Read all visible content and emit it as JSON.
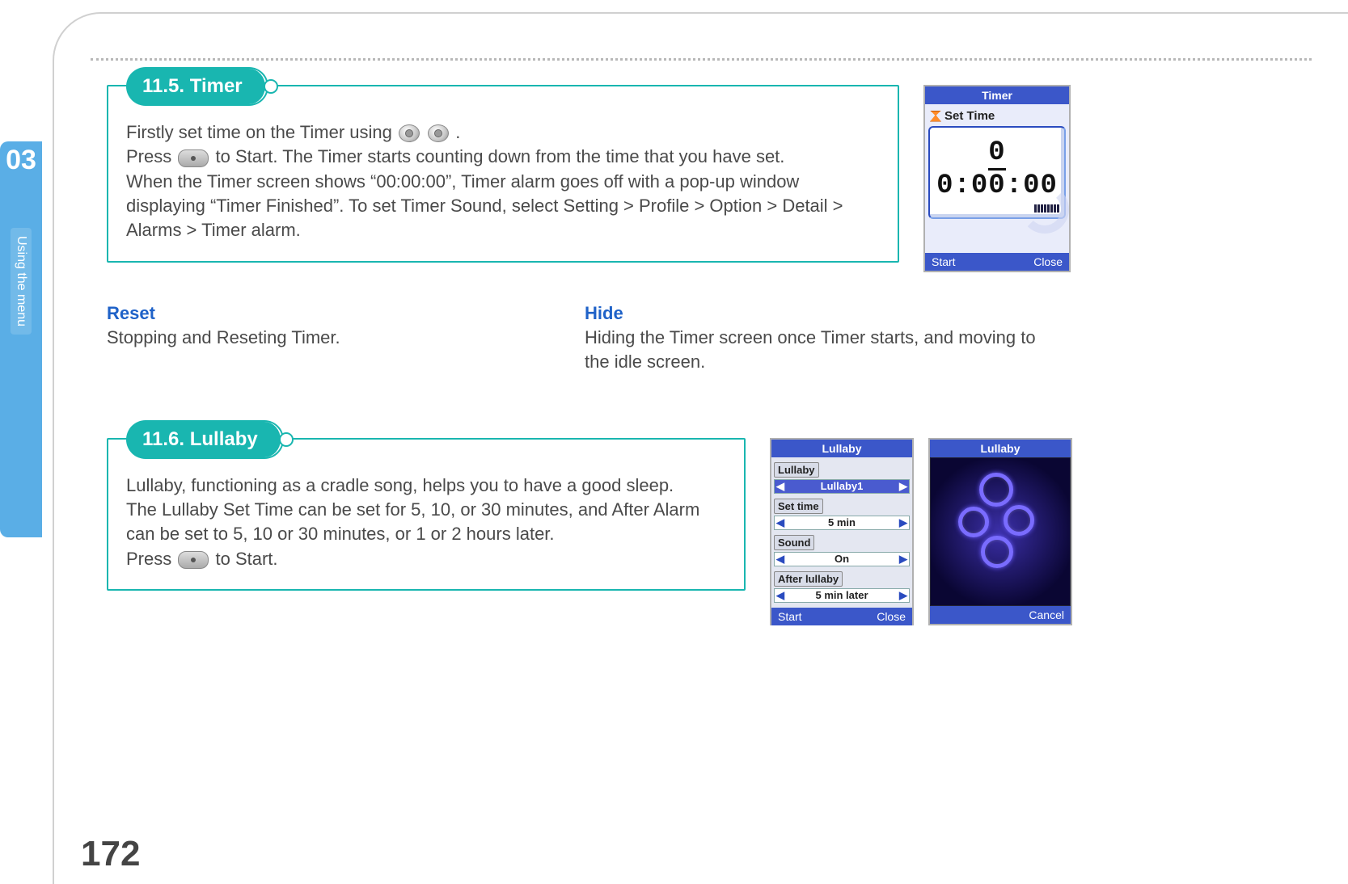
{
  "chapter": {
    "number": "03",
    "title": "Using the menu"
  },
  "page_number": "172",
  "section_timer": {
    "heading": "11.5. Timer",
    "line1_a": "Firstly set time on the Timer using ",
    "line1_b": ".",
    "line2_a": "Press ",
    "line2_b": " to Start. The Timer starts counting down from the time that you have set.",
    "line3": "When the Timer screen shows “00:00:00”, Timer alarm goes off with a pop-up window displaying “Timer Finished”. To set Timer Sound, select Setting > Profile > Option > Detail > Alarms > Timer alarm."
  },
  "reset": {
    "heading": "Reset",
    "body": "Stopping and Reseting Timer."
  },
  "hide": {
    "heading": "Hide",
    "body": "Hiding the Timer screen once Timer starts, and moving to the idle screen."
  },
  "section_lullaby": {
    "heading": "11.6. Lullaby",
    "line1": "Lullaby, functioning as a cradle song, helps you to have a good sleep.",
    "line2": "The Lullaby Set Time can be set for 5, 10, or 30 minutes, and After Alarm can be set to 5, 10 or 30 minutes, or 1 or 2 hours later.",
    "line3_a": "Press ",
    "line3_b": " to Start."
  },
  "timer_screen": {
    "title": "Timer",
    "set_time_label": "Set Time",
    "digits": "00:00:00",
    "left_soft": "Start",
    "right_soft": "Close"
  },
  "lullaby_screen1": {
    "title": "Lullaby",
    "field_lullaby": "Lullaby",
    "val_lullaby": "Lullaby1",
    "field_settime": "Set time",
    "val_settime": "5 min",
    "field_sound": "Sound",
    "val_sound": "On",
    "field_after": "After lullaby",
    "val_after": "5 min later",
    "left_soft": "Start",
    "right_soft": "Close"
  },
  "lullaby_screen2": {
    "title": "Lullaby",
    "right_soft": "Cancel"
  }
}
